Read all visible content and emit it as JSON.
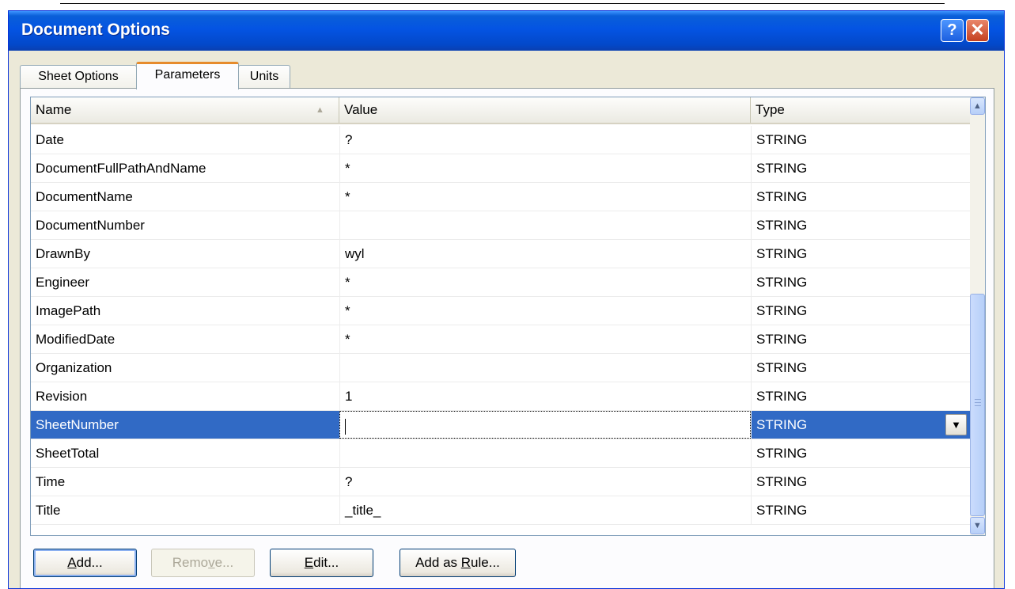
{
  "window": {
    "title": "Document Options",
    "help_glyph": "?",
    "close_glyph": "✕"
  },
  "tabs": [
    {
      "label": "Sheet Options",
      "active": false
    },
    {
      "label": "Parameters",
      "active": true
    },
    {
      "label": "Units",
      "active": false
    }
  ],
  "table": {
    "columns": [
      "Name",
      "Value",
      "Type"
    ],
    "sort_indicator": "▲",
    "rows": [
      {
        "name": "Date",
        "value": "?",
        "type": "STRING"
      },
      {
        "name": "DocumentFullPathAndName",
        "value": "*",
        "type": "STRING"
      },
      {
        "name": "DocumentName",
        "value": "*",
        "type": "STRING"
      },
      {
        "name": "DocumentNumber",
        "value": "",
        "type": "STRING"
      },
      {
        "name": "DrawnBy",
        "value": "wyl",
        "type": "STRING"
      },
      {
        "name": "Engineer",
        "value": "*",
        "type": "STRING"
      },
      {
        "name": "ImagePath",
        "value": "*",
        "type": "STRING"
      },
      {
        "name": "ModifiedDate",
        "value": "*",
        "type": "STRING"
      },
      {
        "name": "Organization",
        "value": "",
        "type": "STRING"
      },
      {
        "name": "Revision",
        "value": "1",
        "type": "STRING"
      },
      {
        "name": "SheetNumber",
        "value": "",
        "type": "STRING",
        "selected": true
      },
      {
        "name": "SheetTotal",
        "value": "",
        "type": "STRING"
      },
      {
        "name": "Time",
        "value": "?",
        "type": "STRING"
      },
      {
        "name": "Title",
        "value": "_title_",
        "type": "STRING"
      }
    ],
    "dropdown_glyph": "▼"
  },
  "scrollbar": {
    "up_glyph": "▲",
    "down_glyph": "▼"
  },
  "buttons": {
    "add": {
      "mnemonic": "A",
      "rest": "dd..."
    },
    "remove": {
      "before": "Remo",
      "mnemonic": "v",
      "after": "e..."
    },
    "edit": {
      "mnemonic": "E",
      "rest": "dit..."
    },
    "add_as_rule": {
      "before": "Add as ",
      "mnemonic": "R",
      "after": "ule..."
    }
  }
}
